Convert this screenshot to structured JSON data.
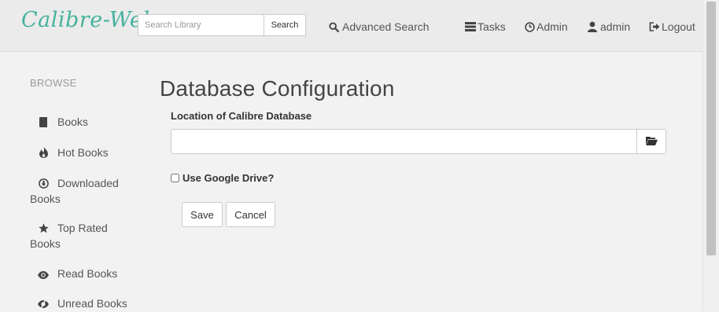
{
  "navbar": {
    "brand": "Calibre-Web",
    "search": {
      "placeholder": "Search Library",
      "value": "",
      "button_label": "Search"
    },
    "links": {
      "advanced_search": "Advanced Search",
      "tasks": "Tasks",
      "admin_panel": "Admin",
      "user": "admin",
      "logout": "Logout"
    }
  },
  "sidebar": {
    "heading": "BROWSE",
    "items": [
      {
        "label_line1": "Books",
        "label_line2": "",
        "icon": "book-icon"
      },
      {
        "label_line1": "Hot Books",
        "label_line2": "",
        "icon": "fire-icon"
      },
      {
        "label_line1": "Downloaded",
        "label_line2": "Books",
        "icon": "download-icon"
      },
      {
        "label_line1": "Top Rated",
        "label_line2": "Books",
        "icon": "star-icon"
      },
      {
        "label_line1": "Read Books",
        "label_line2": "",
        "icon": "eye-open-icon"
      },
      {
        "label_line1": "Unread Books",
        "label_line2": "",
        "icon": "eye-closed-icon"
      }
    ]
  },
  "main": {
    "title": "Database Configuration",
    "location_label": "Location of Calibre Database",
    "location_value": "",
    "google_drive_label": "Use Google Drive?",
    "google_drive_checked": false,
    "save_label": "Save",
    "cancel_label": "Cancel"
  },
  "colors": {
    "brand": "#45b29d",
    "background": "#f2f2f2",
    "navbar": "#ebebeb"
  }
}
